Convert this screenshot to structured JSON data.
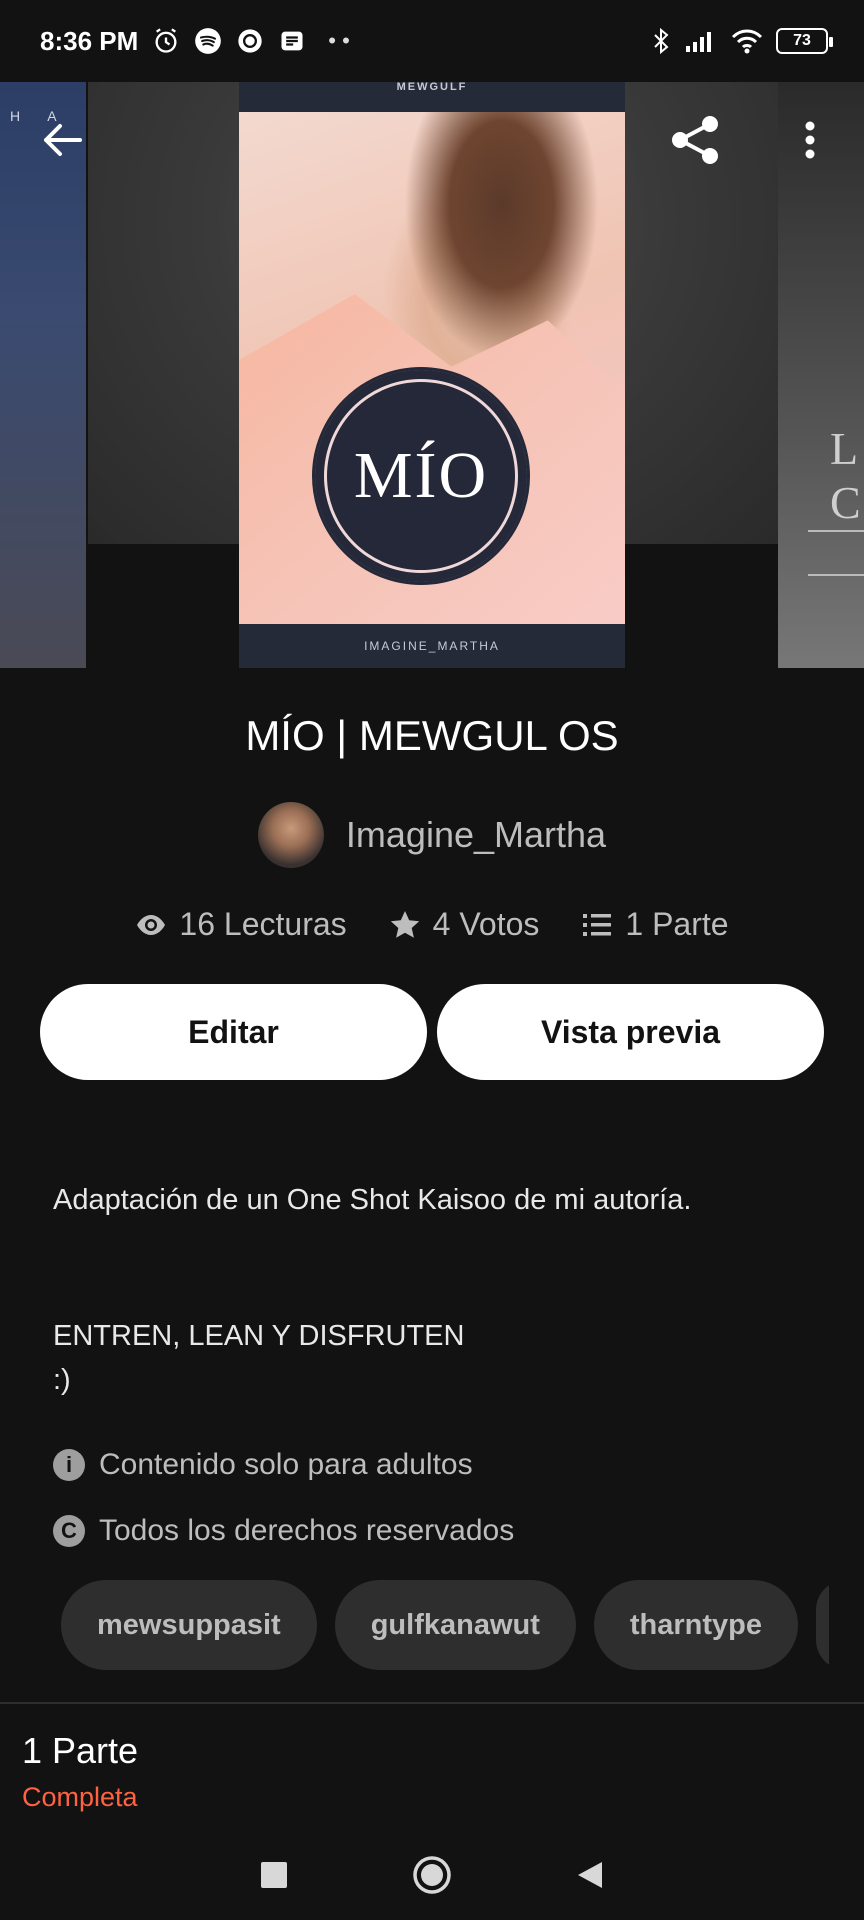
{
  "status_bar": {
    "time": "8:36 PM",
    "battery": "73",
    "dots": "• •"
  },
  "cover": {
    "top_text": "MEWGULF",
    "badge_text": "MÍO",
    "bottom_text": "IMAGINE_MARTHA",
    "left_cover_letters": "H A",
    "right_cover_letters": "L C"
  },
  "story": {
    "title": "MÍO | MEWGUL OS",
    "author": "Imagine_Martha"
  },
  "stats": {
    "reads": "16 Lecturas",
    "votes": "4 Votos",
    "parts": "1 Parte"
  },
  "actions": {
    "edit": "Editar",
    "preview": "Vista previa"
  },
  "description": {
    "line1": "Adaptación de un One Shot Kaisoo de mi autoría.",
    "line2": "ENTREN, LEAN Y DISFRUTEN",
    "line3": ":)"
  },
  "info": {
    "mature": "Contenido solo para adultos",
    "copyright": "Todos los derechos reservados",
    "mature_icon": "i",
    "copyright_icon": "C"
  },
  "tags": [
    "mewsuppasit",
    "gulfkanawut",
    "tharntype"
  ],
  "footer": {
    "parts_count": "1 Parte",
    "parts_status": "Completa"
  },
  "colors": {
    "background": "#121212",
    "accent": "#ff6240",
    "button_bg": "#ffffff"
  }
}
